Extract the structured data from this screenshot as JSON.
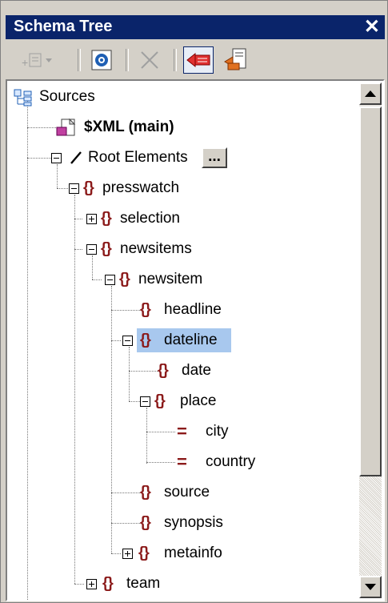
{
  "window": {
    "title": "Schema Tree",
    "close_glyph": "✕"
  },
  "toolbar": {
    "add_item": "add-item-dropdown",
    "show_hide": "show-schema",
    "remove": "remove",
    "sync": "sync-to-schema",
    "reload": "reload"
  },
  "tree": {
    "sources": "Sources",
    "xml_main": "$XML (main)",
    "root_elements": "Root Elements",
    "root_elements_button": "...",
    "presswatch": "presswatch",
    "selection": "selection",
    "newsitems": "newsitems",
    "newsitem": "newsitem",
    "headline": "headline",
    "dateline": "dateline",
    "date": "date",
    "place": "place",
    "city": "city",
    "country": "country",
    "source": "source",
    "synopsis": "synopsis",
    "metainfo": "metainfo",
    "team": "team"
  },
  "colors": {
    "title_bg": "#0a246a",
    "selection_bg": "#a8c8ee",
    "element_icon": "#8b1a1a"
  }
}
